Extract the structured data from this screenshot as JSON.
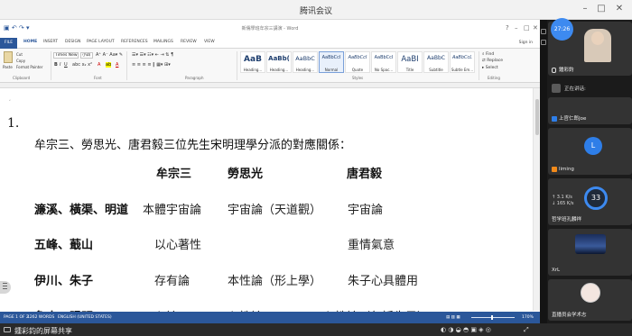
{
  "meeting": {
    "title": "腾讯会议",
    "share_label": "鍾彩鈞的屏幕共享"
  },
  "word": {
    "doc_title": "新儒學班牟宗三講演 - Word",
    "tabs": [
      "FILE",
      "HOME",
      "INSERT",
      "DESIGN",
      "PAGE LAYOUT",
      "REFERENCES",
      "MAILINGS",
      "REVIEW",
      "VIEW"
    ],
    "active_tab": "HOME",
    "sign_in": "Sign in",
    "clipboard": {
      "paste": "Paste",
      "cut": "Cut",
      "copy": "Copy",
      "format_painter": "Format Painter",
      "group_label": "Clipboard"
    },
    "font": {
      "name": "Times New R",
      "size": "小四",
      "group_label": "Font"
    },
    "paragraph_label": "Paragraph",
    "styles": {
      "group_label": "Styles",
      "items": [
        {
          "sample": "AaB",
          "name": "Heading..."
        },
        {
          "sample": "AaBb(",
          "name": "Heading..."
        },
        {
          "sample": "AaBbC",
          "name": "Heading..."
        },
        {
          "sample": "AaBbCcI",
          "name": "Normal"
        },
        {
          "sample": "AaBbCcI",
          "name": "Quote"
        },
        {
          "sample": "AaBbCcI",
          "name": "No Spac..."
        },
        {
          "sample": "AaBI",
          "name": "Title"
        },
        {
          "sample": "AaBbC",
          "name": "Subtitle"
        },
        {
          "sample": "AaBbCcL",
          "name": "Subtle Em..."
        }
      ]
    },
    "editing": {
      "find": "Find",
      "replace": "Replace",
      "select": "Select",
      "group_label": "Editing"
    },
    "status": {
      "page": "PAGE 1 OF 2",
      "words": "1262 WORDS",
      "language": "ENGLISH (UNITED STATES)",
      "zoom": "170%"
    }
  },
  "document": {
    "heading": "1.",
    "intro": "牟宗三、勞思光、唐君毅三位先生宋明理學分派的對應關係：",
    "columns": [
      "牟宗三",
      "勞思光",
      "唐君毅"
    ],
    "rows": [
      {
        "school": "濂溪、橫渠、明道",
        "mou": "本體宇宙論",
        "lao": "宇宙論（天道觀）",
        "tang": "宇宙論"
      },
      {
        "school": "五峰、蕺山",
        "mou": "以心著性",
        "lao": "",
        "tang": "重情氣意"
      },
      {
        "school": "伊川、朱子",
        "mou": "存有論",
        "lao": "本性論（形上學）",
        "tang": "朱子心具體用"
      },
      {
        "school": "象山、陽明",
        "mou": "心論",
        "lao": "心性論",
        "tang": "心性論（包括朱子）"
      }
    ]
  },
  "side_panel": {
    "clock": "27:26",
    "host_name": "鍾彩鈞",
    "speaking_label": "正在讲话:",
    "participants": [
      {
        "name": "上官仁郎Joe"
      },
      {
        "name": "liming",
        "avatar_letter": "L"
      },
      {
        "name": "哲学班孔麟祥",
        "gauge": "33",
        "upload": "3.1",
        "download": "165",
        "unit": "K/s"
      },
      {
        "name": "XrL"
      },
      {
        "name": "直播员会学术志"
      }
    ]
  },
  "colors": {
    "word_blue": "#2b579a",
    "meeting_blue": "#3d8af0",
    "panel_bg": "#1b1b1b"
  }
}
